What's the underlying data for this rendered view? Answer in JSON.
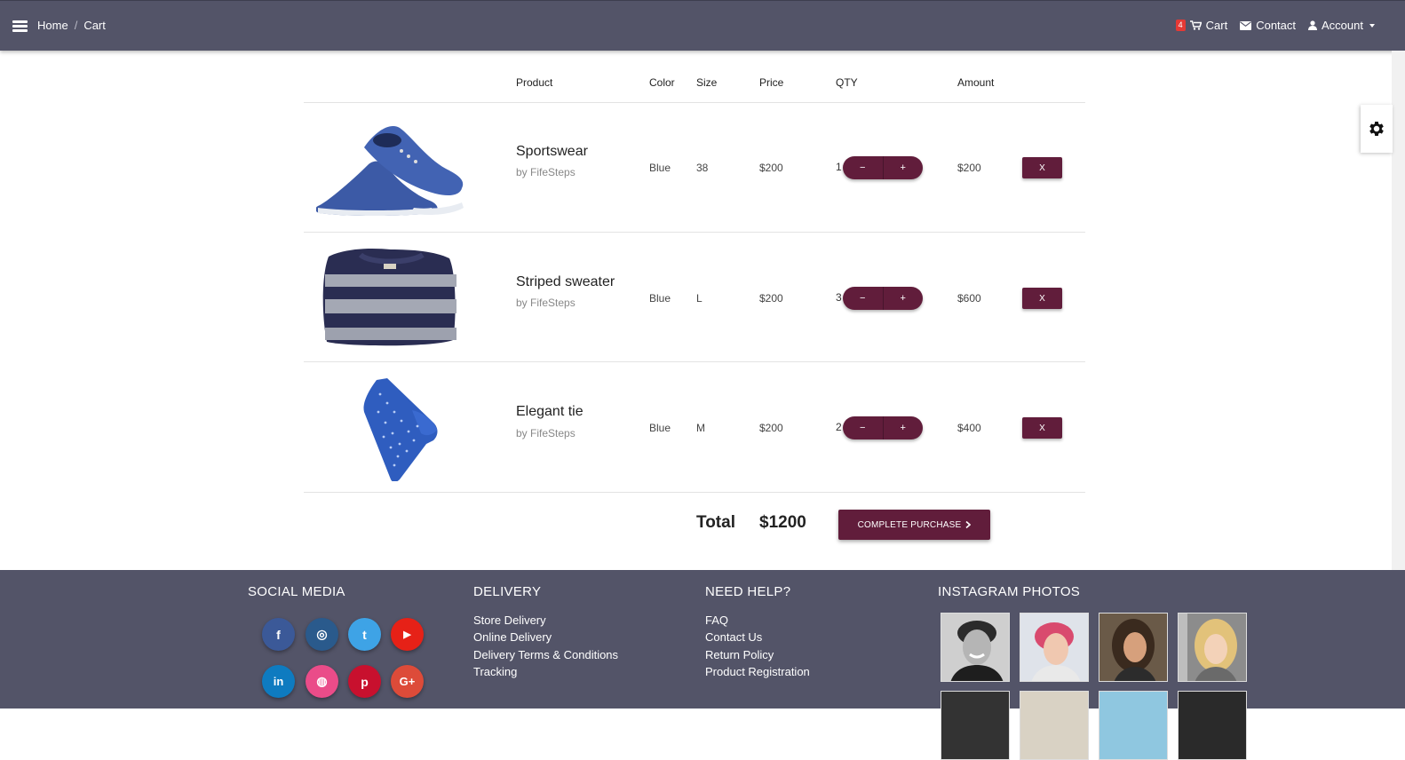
{
  "nav": {
    "breadcrumb": [
      "Home",
      "Cart"
    ],
    "cart_count": "4",
    "cart_label": "Cart",
    "contact_label": "Contact",
    "account_label": "Account"
  },
  "table": {
    "headers": {
      "product": "Product",
      "color": "Color",
      "size": "Size",
      "price": "Price",
      "qty": "QTY",
      "amount": "Amount"
    }
  },
  "items": [
    {
      "name": "Sportswear",
      "brand": "by FifeSteps",
      "color": "Blue",
      "size": "38",
      "price": "$200",
      "qty": "1",
      "amount": "$200",
      "minus": "−",
      "plus": "+",
      "remove": "X"
    },
    {
      "name": "Striped sweater",
      "brand": "by FifeSteps",
      "color": "Blue",
      "size": "L",
      "price": "$200",
      "qty": "3",
      "amount": "$600",
      "minus": "−",
      "plus": "+",
      "remove": "X"
    },
    {
      "name": "Elegant tie",
      "brand": "by FifeSteps",
      "color": "Blue",
      "size": "M",
      "price": "$200",
      "qty": "2",
      "amount": "$400",
      "minus": "−",
      "plus": "+",
      "remove": "X"
    }
  ],
  "summary": {
    "total_label": "Total",
    "total_value": "$1200",
    "checkout_label": "COMPLETE PURCHASE"
  },
  "footer": {
    "social_title": "SOCIAL MEDIA",
    "delivery_title": "DELIVERY",
    "delivery_links": [
      "Store Delivery",
      "Online Delivery",
      "Delivery Terms & Conditions",
      "Tracking"
    ],
    "help_title": "NEED HELP?",
    "help_links": [
      "FAQ",
      "Contact Us",
      "Return Policy",
      "Product Registration"
    ],
    "instagram_title": "INSTAGRAM PHOTOS",
    "social_icons": [
      {
        "name": "facebook",
        "glyph": "f",
        "color": "#3b5998"
      },
      {
        "name": "instagram",
        "glyph": "◎",
        "color": "#2a5a8c"
      },
      {
        "name": "twitter",
        "glyph": "t",
        "color": "#3ea3e6"
      },
      {
        "name": "youtube",
        "glyph": "▶",
        "color": "#e62117"
      },
      {
        "name": "linkedin",
        "glyph": "in",
        "color": "#0e7bc0"
      },
      {
        "name": "dribbble",
        "glyph": "◍",
        "color": "#ea4c89"
      },
      {
        "name": "pinterest",
        "glyph": "p",
        "color": "#c8102e"
      },
      {
        "name": "google-plus",
        "glyph": "G+",
        "color": "#dd4b39"
      }
    ]
  },
  "colors": {
    "topbar": "#535468",
    "accent": "#611d3b",
    "badge": "#e53935"
  }
}
